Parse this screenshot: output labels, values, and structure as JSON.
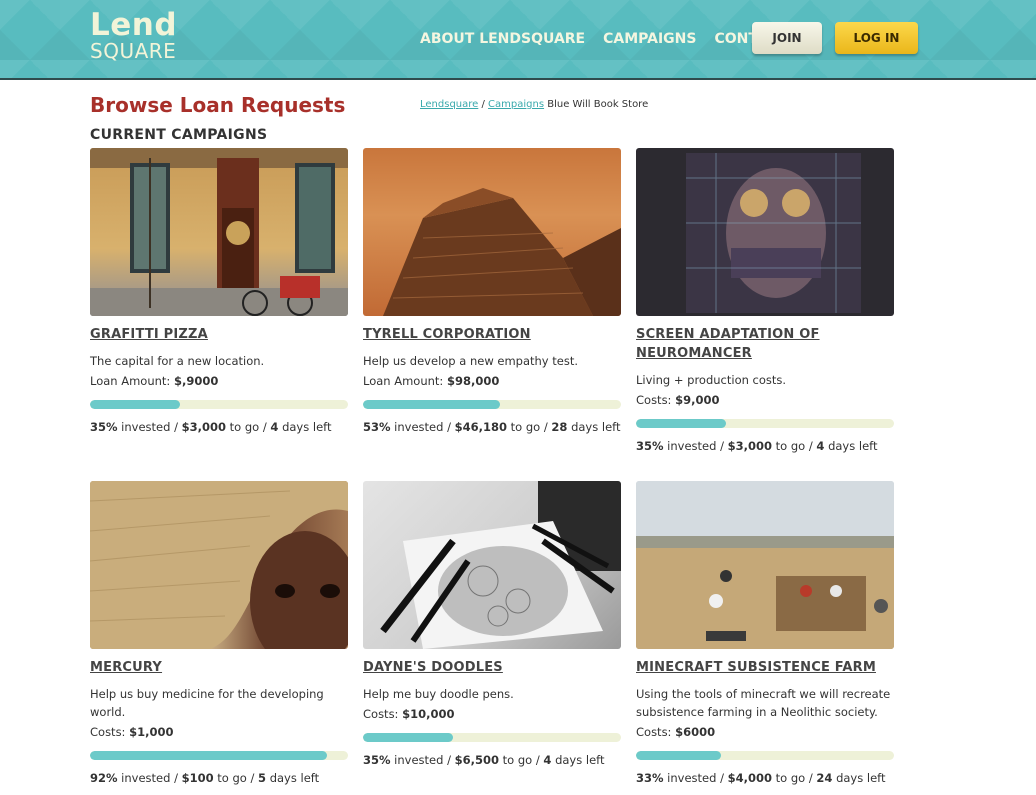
{
  "header": {
    "logo_line1": "Lend",
    "logo_line2": "SQUARE",
    "nav": [
      "ABOUT LENDSQUARE",
      "CAMPAIGNS",
      "CONTACT"
    ],
    "join_label": "JOIN",
    "login_label": "LOG IN"
  },
  "page": {
    "title": "Browse Loan Requests",
    "breadcrumb": {
      "link1": "Lendsquare",
      "sep1": " / ",
      "link2": "Campaigns",
      "current": " Blue Will Book Store"
    },
    "section_title": "CURRENT CAMPAIGNS"
  },
  "colors": {
    "header_bg": "#58bcbf",
    "title_red": "#a8302a",
    "progress_fill": "#6ccac9",
    "progress_track": "#eef1d8",
    "login_yellow": "#f4c52e"
  },
  "campaigns": [
    {
      "title": "GRAFITTI PIZZA",
      "description": "The capital for a new location.",
      "amount_label": "Loan Amount:",
      "amount": "$,9000",
      "progress": 0.35,
      "percent": "35%",
      "invested_text": " invested / ",
      "to_go": "$3,000",
      "to_go_text": " to go / ",
      "days": "4",
      "days_text": " days left",
      "image": "storefront-photo"
    },
    {
      "title": "TYRELL CORPORATION",
      "description": "Help us develop a new empathy test.",
      "amount_label": "Loan Amount:",
      "amount": "$98,000",
      "progress": 0.53,
      "percent": "53%",
      "invested_text": " invested / ",
      "to_go": "$46,180",
      "to_go_text": " to go / ",
      "days": "28",
      "days_text": " days left",
      "image": "pyramid-building-photo"
    },
    {
      "title": "SCREEN ADAPTATION OF NEUROMANCER",
      "description": "Living + production costs.",
      "amount_label": "Costs:",
      "amount": "$9,000",
      "progress": 0.35,
      "percent": "35%",
      "invested_text": " invested / ",
      "to_go": "$3,000",
      "to_go_text": " to go / ",
      "days": "4",
      "days_text": " days left",
      "image": "cyberpunk-face-art"
    },
    {
      "title": "MERCURY",
      "description": "Help us buy medicine for the developing world.",
      "amount_label": "Costs:",
      "amount": "$1,000",
      "progress": 0.92,
      "percent": "92%",
      "invested_text": " invested / ",
      "to_go": "$100",
      "to_go_text": " to go / ",
      "days": "5",
      "days_text": " days left",
      "image": "child-with-hat-photo"
    },
    {
      "title": "DAYNE'S DOODLES",
      "description": "Help me buy doodle pens.",
      "amount_label": "Costs:",
      "amount": "$10,000",
      "progress": 0.35,
      "percent": "35%",
      "invested_text": " invested / ",
      "to_go": "$6,500",
      "to_go_text": " to go / ",
      "days": "4",
      "days_text": " days left",
      "image": "doodle-pens-photo"
    },
    {
      "title": "MINECRAFT SUBSISTENCE FARM",
      "description": "Using the tools of minecraft we will recreate subsistence farming in a Neolithic society.",
      "amount_label": "Costs:",
      "amount": "$6000",
      "progress": 0.33,
      "percent": "33%",
      "invested_text": " invested / ",
      "to_go": "$4,000",
      "to_go_text": " to go / ",
      "days": "24",
      "days_text": " days left",
      "image": "excavation-site-photo"
    }
  ]
}
